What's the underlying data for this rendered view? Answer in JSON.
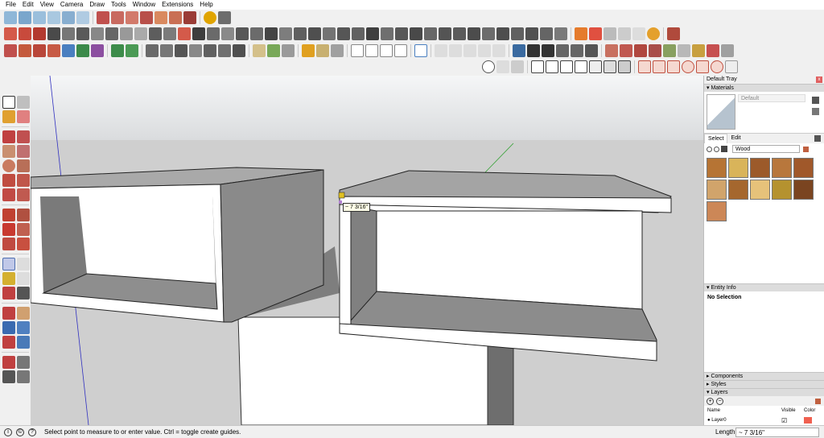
{
  "menu": [
    "File",
    "Edit",
    "View",
    "Camera",
    "Draw",
    "Tools",
    "Window",
    "Extensions",
    "Help"
  ],
  "tooltip": "~ 7 3/16\"",
  "tray": {
    "title": "Default Tray",
    "close": "x",
    "materials": {
      "header": "▾ Materials",
      "current": "Default",
      "tabs": [
        "Select",
        "Edit"
      ],
      "collection": "Wood",
      "swatches": [
        "#b67434",
        "#d9b45a",
        "#9c5a2a",
        "#b8773c",
        "#a0582a",
        "#d1a46b",
        "#a5672e",
        "#e6c27a",
        "#b5922f",
        "#7a4420",
        "#cc8757"
      ]
    },
    "entity": {
      "header": "▾ Entity Info",
      "status": "No Selection"
    },
    "components": "▸ Components",
    "styles": "▸ Styles",
    "layers": {
      "header": "▾ Layers",
      "add": "+",
      "remove": "−",
      "col_name": "Name",
      "col_visible": "Visible",
      "col_color": "Color",
      "rows": [
        {
          "name": "Layer0",
          "visible": "☑",
          "color": "#f06050"
        }
      ]
    }
  },
  "status": {
    "text": "Select point to measure to or enter value.  Ctrl = toggle create guides.",
    "vcb_label": "Length",
    "vcb_value": "~ 7 3/16\""
  },
  "colors": {
    "model_top": "#dddddd",
    "model_side": "#888888",
    "model_face": "#ffffff",
    "ground": "#cfcfcf",
    "sky": "#eef0f2"
  }
}
